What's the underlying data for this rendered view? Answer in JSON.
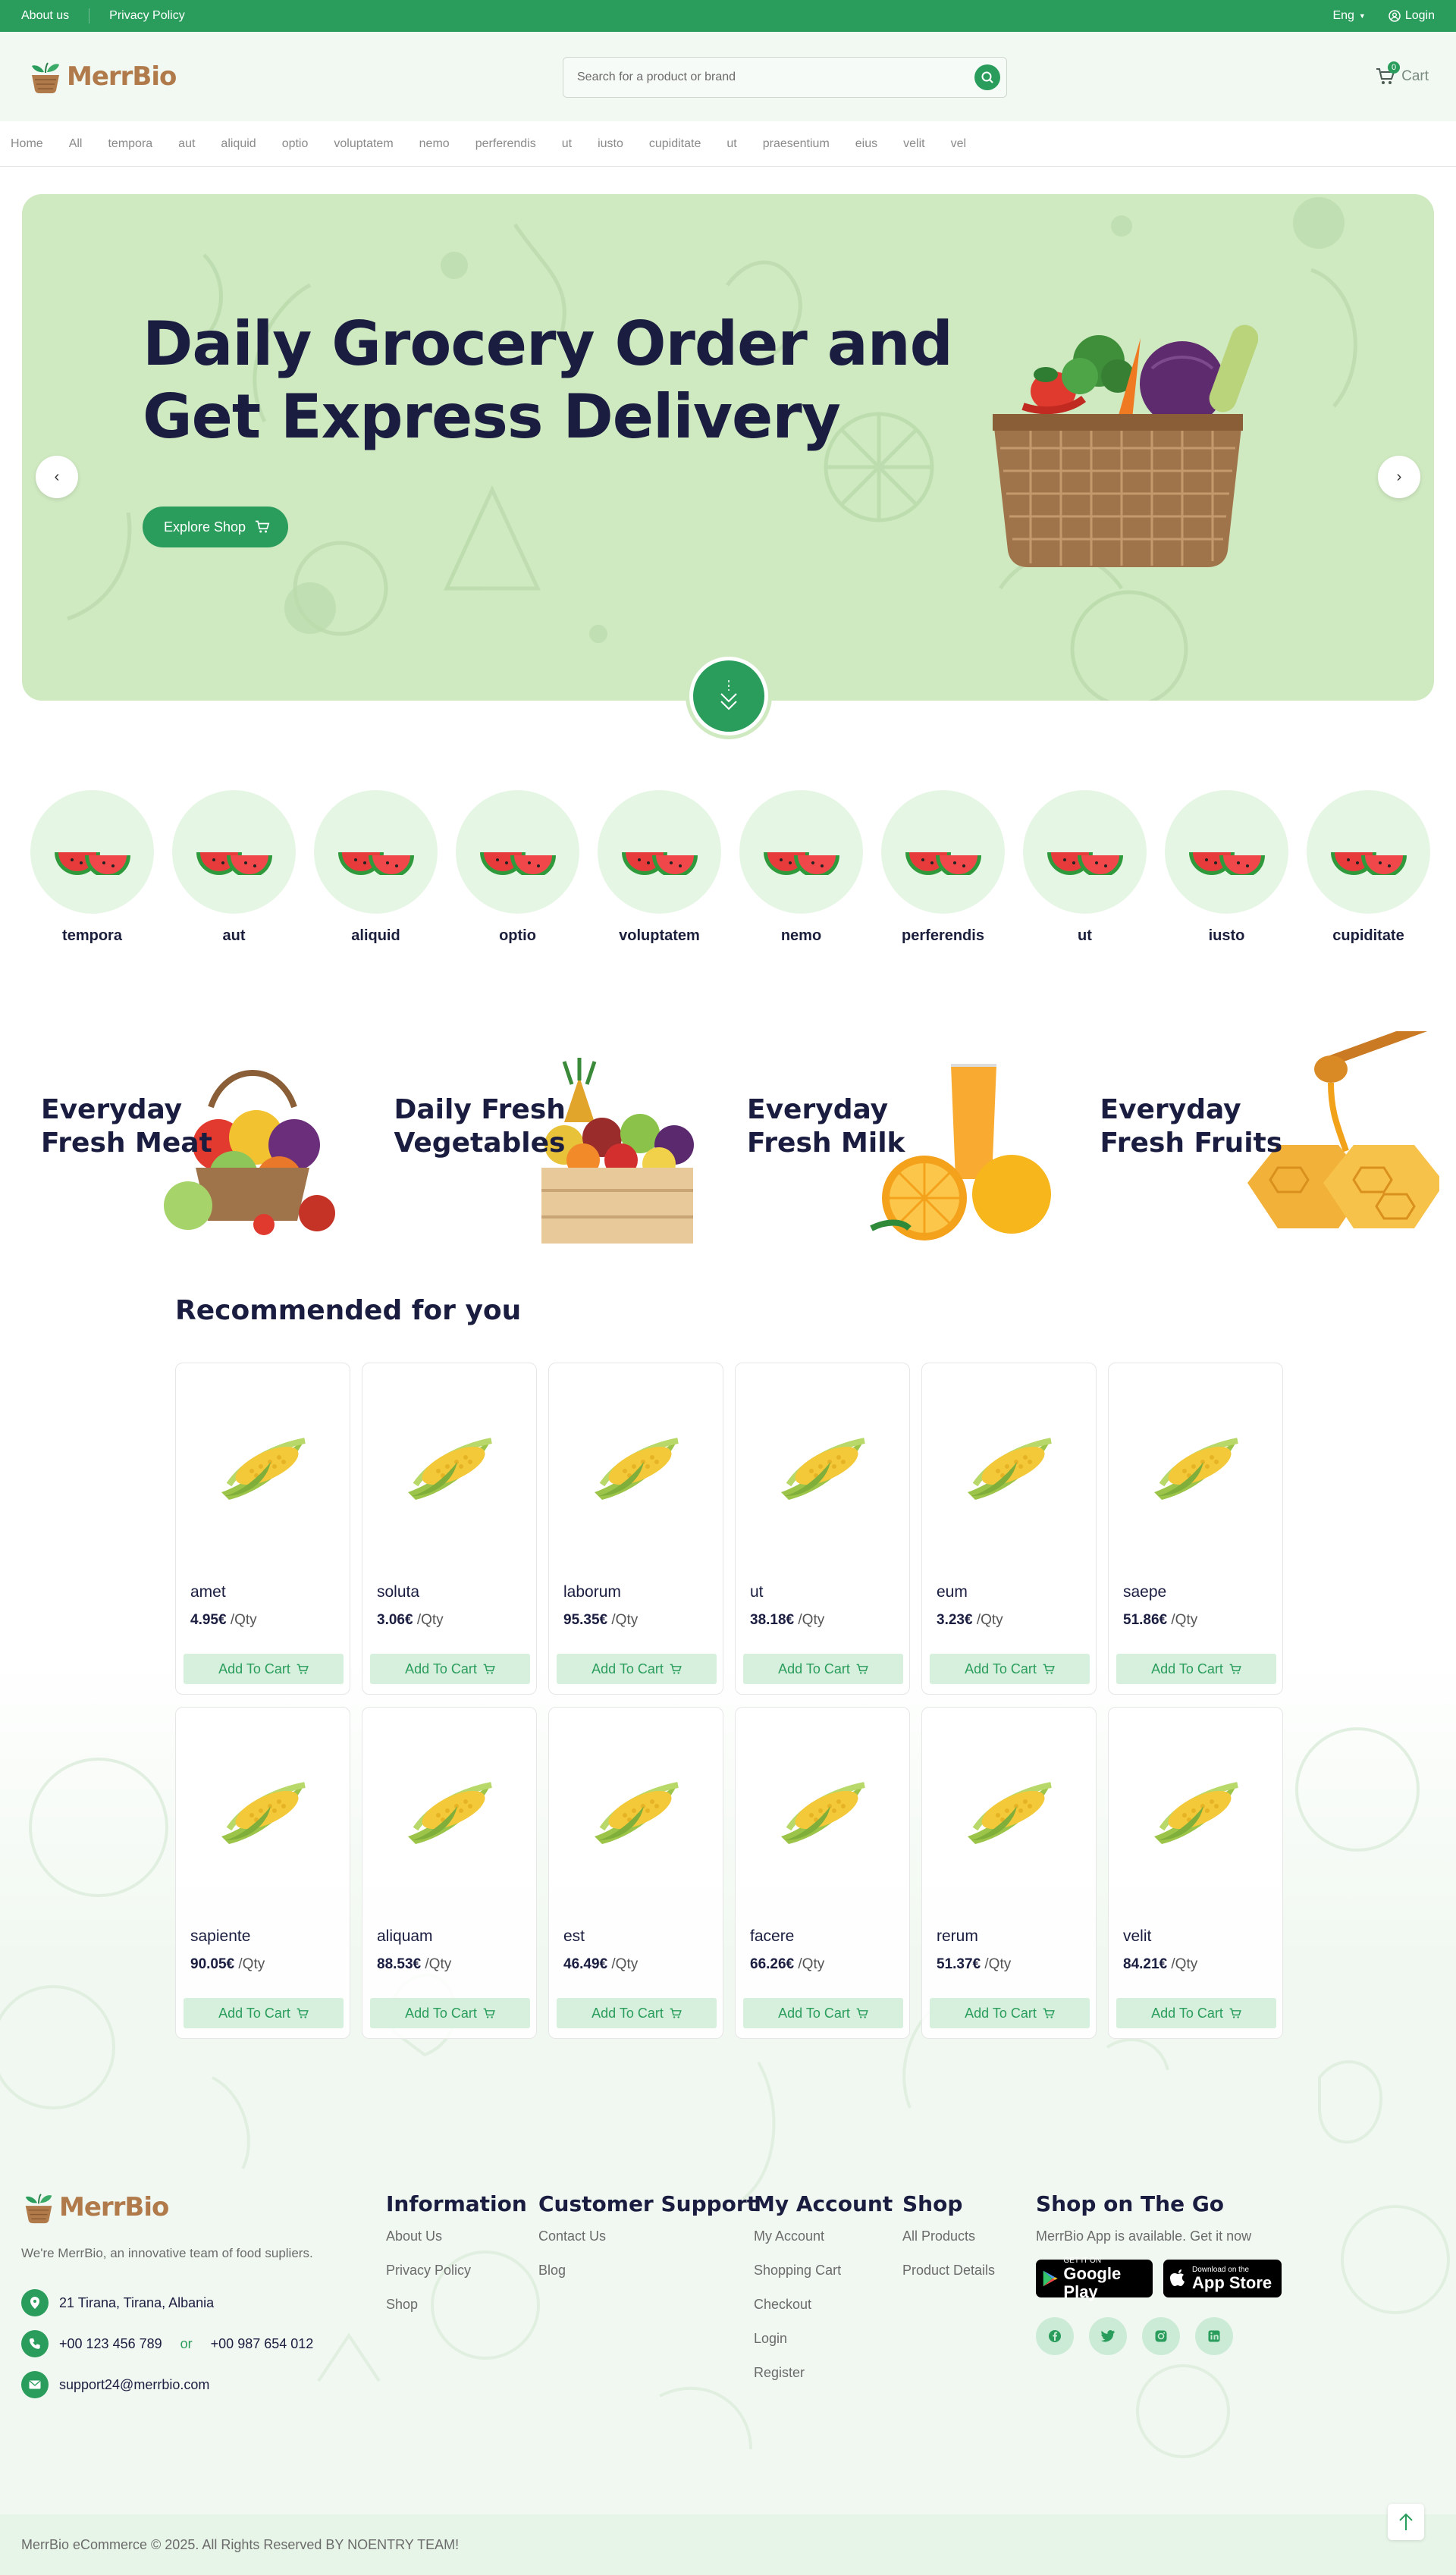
{
  "topbar": {
    "about": "About us",
    "privacy": "Privacy Policy",
    "lang": "Eng",
    "login": "Login"
  },
  "header": {
    "brand": "MerrBio",
    "search_placeholder": "Search for a product or brand",
    "cart_label": "Cart",
    "cart_count": "0"
  },
  "nav": [
    "Home",
    "All",
    "tempora",
    "aut",
    "aliquid",
    "optio",
    "voluptatem",
    "nemo",
    "perferendis",
    "ut",
    "iusto",
    "cupiditate",
    "ut",
    "praesentium",
    "eius",
    "velit",
    "vel"
  ],
  "hero": {
    "title_line1": "Daily Grocery Order and",
    "title_line2": "Get Express Delivery",
    "button": "Explore Shop"
  },
  "categories": [
    "tempora",
    "aut",
    "aliquid",
    "optio",
    "voluptatem",
    "nemo",
    "perferendis",
    "ut",
    "iusto",
    "cupiditate"
  ],
  "promos": [
    {
      "line1": "Everyday",
      "line2": "Fresh Meat"
    },
    {
      "line1": "Daily Fresh",
      "line2": "Vegetables"
    },
    {
      "line1": "Everyday",
      "line2": "Fresh Milk"
    },
    {
      "line1": "Everyday",
      "line2": "Fresh Fruits"
    }
  ],
  "recommended": {
    "title": "Recommended for you",
    "unit": "/Qty",
    "button": "Add To Cart",
    "products": [
      {
        "name": "amet",
        "price": "4.95€"
      },
      {
        "name": "soluta",
        "price": "3.06€"
      },
      {
        "name": "laborum",
        "price": "95.35€"
      },
      {
        "name": "ut",
        "price": "38.18€"
      },
      {
        "name": "eum",
        "price": "3.23€"
      },
      {
        "name": "saepe",
        "price": "51.86€"
      },
      {
        "name": "sapiente",
        "price": "90.05€"
      },
      {
        "name": "aliquam",
        "price": "88.53€"
      },
      {
        "name": "est",
        "price": "46.49€"
      },
      {
        "name": "facere",
        "price": "66.26€"
      },
      {
        "name": "rerum",
        "price": "51.37€"
      },
      {
        "name": "velit",
        "price": "84.21€"
      }
    ]
  },
  "footer": {
    "brand": "MerrBio",
    "about": "We're MerrBio, an innovative team of food supliers.",
    "address": "21 Tirana, Tirana, Albania",
    "phone1": "+00 123 456 789",
    "or": "or",
    "phone2": "+00 987 654 012",
    "email": "support24@merrbio.com",
    "information": {
      "title": "Information",
      "links": [
        "About Us",
        "Privacy Policy",
        "Shop"
      ]
    },
    "support": {
      "title": "Customer Support",
      "links": [
        "Contact Us",
        "Blog"
      ]
    },
    "account": {
      "title": "My Account",
      "links": [
        "My Account",
        "Shopping Cart",
        "Checkout",
        "Login",
        "Register"
      ]
    },
    "shop": {
      "title": "Shop",
      "links": [
        "All Products",
        "Product Details"
      ]
    },
    "onthego": {
      "title": "Shop on The Go",
      "text": "MerrBio App is available. Get it now",
      "google_small": "GET IT ON",
      "google_big": "Google Play",
      "apple_small": "Download on the",
      "apple_big": "App Store"
    },
    "socials": [
      "facebook-icon",
      "twitter-icon",
      "instagram-icon",
      "linkedin-icon"
    ],
    "copyright": "MerrBio eCommerce © 2025. All Rights Reserved BY NOENTRY TEAM!"
  },
  "colors": {
    "primary": "#2a9d5c",
    "hero_bg": "#cfe9c1",
    "header_bg": "#f1f9f2",
    "title": "#1a1d3f"
  }
}
